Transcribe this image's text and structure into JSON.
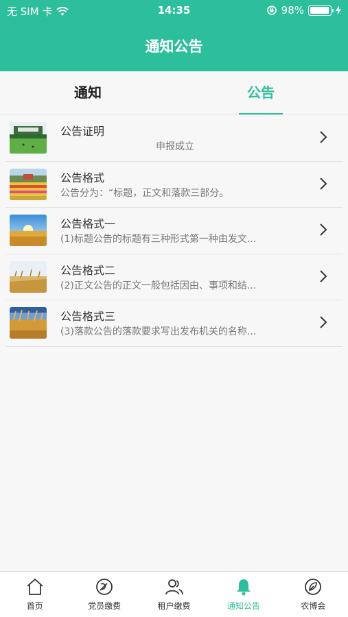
{
  "status_bar": {
    "carrier": "无 SIM 卡",
    "time": "14:35",
    "battery": "98%",
    "battery_level": 0.98
  },
  "header": {
    "title": "通知公告"
  },
  "tabs": [
    {
      "label": "通知",
      "active": false
    },
    {
      "label": "公告",
      "active": true
    }
  ],
  "announcements": [
    {
      "title": "公告证明",
      "description": "申报成立"
    },
    {
      "title": "公告格式",
      "description": "公告分为：“标题，正文和落款三部分。"
    },
    {
      "title": "公告格式一",
      "description": "(1)标题公告的标题有三种形式第一种由发文..."
    },
    {
      "title": "公告格式二",
      "description": "(2)正文公告的正文一般包括因由、事项和结..."
    },
    {
      "title": "公告格式三",
      "description": "(3)落款公告的落款要求写出发布机关的名称..."
    }
  ],
  "bottom_nav": [
    {
      "label": "首页",
      "icon": "home-icon"
    },
    {
      "label": "党员缴费",
      "icon": "party-emblem-icon"
    },
    {
      "label": "租户缴费",
      "icon": "users-icon"
    },
    {
      "label": "通知公告",
      "icon": "bell-icon",
      "active": true
    },
    {
      "label": "农博会",
      "icon": "leaf-badge-icon"
    }
  ],
  "colors": {
    "accent": "#2dbf9c"
  }
}
